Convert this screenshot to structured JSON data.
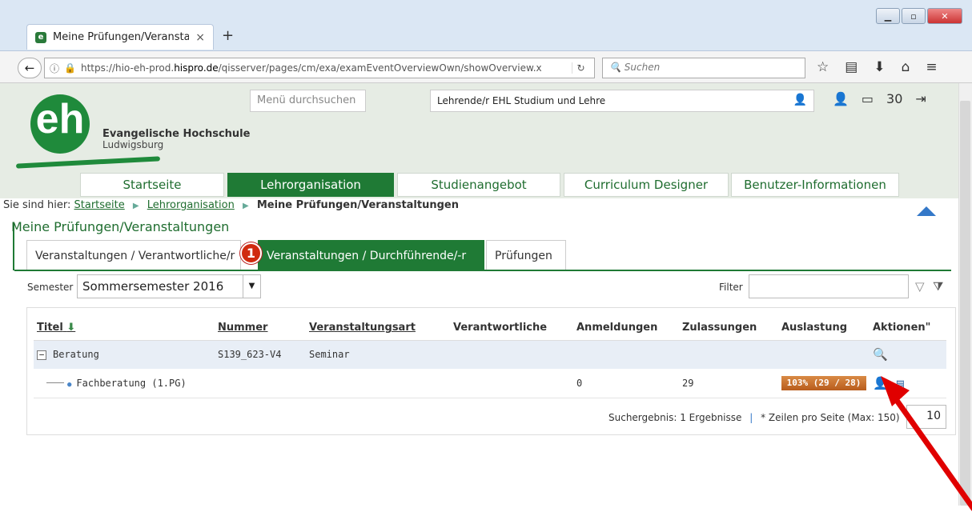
{
  "browser": {
    "tab_title": "Meine Prüfungen/Veransta...",
    "tab_close": "×",
    "new_tab": "+",
    "url_prefix": "https://hio-eh-prod.",
    "url_domain": "hispro.de",
    "url_path": "/qisserver/pages/cm/exa/examEventOverviewOwn/showOverview.x",
    "search_placeholder": "Suchen"
  },
  "logo": {
    "mark": "eh",
    "line1": "Evangelische Hochschule",
    "line2": "Ludwigsburg"
  },
  "header": {
    "menu_search_placeholder": "Menü durchsuchen",
    "role": "Lehrende/r EHL Studium und Lehre",
    "message_count": "30"
  },
  "main_nav": [
    "Startseite",
    "Lehrorganisation",
    "Studienangebot",
    "Curriculum Designer",
    "Benutzer-Informationen"
  ],
  "breadcrumb": {
    "prefix": "Sie sind hier:",
    "items": [
      "Startseite",
      "Lehrorganisation"
    ],
    "current": "Meine Prüfungen/Veranstaltungen"
  },
  "page_title": "Meine Prüfungen/Veranstaltungen",
  "sub_tabs": [
    "Veranstaltungen / Verantwortliche/r",
    "Veranstaltungen / Durchführende/-r",
    "Prüfungen"
  ],
  "badge_number": "1",
  "semester": {
    "label": "Semester",
    "value": "Sommersemester 2016"
  },
  "filter": {
    "label": "Filter",
    "value": ""
  },
  "table": {
    "columns": [
      "Titel",
      "Nummer",
      "Veranstaltungsart",
      "Verantwortliche",
      "Anmeldungen",
      "Zulassungen",
      "Auslastung",
      "Aktionen\""
    ],
    "rows": [
      {
        "titel": "Beratung",
        "nummer": "S139_623-V4",
        "art": "Seminar",
        "verantwortliche": "",
        "anmeldungen": "",
        "zulassungen": "",
        "auslastung": ""
      },
      {
        "titel": "Fachberatung (1.PG)",
        "nummer": "",
        "art": "",
        "verantwortliche": "",
        "anmeldungen": "0",
        "zulassungen": "29",
        "auslastung": "103% (29 / 28)",
        "auslastung_fraction": 1.0
      }
    ]
  },
  "results": {
    "text": "Suchergebnis: 1 Ergebnisse",
    "perpage_label": "* Zeilen pro Seite (Max: 150)",
    "perpage_value": "10"
  },
  "colors": {
    "green": "#1f7a35",
    "badge_red": "#d02a0f",
    "bar_orange": "#c96f2d",
    "arrow_red": "#e00000"
  }
}
